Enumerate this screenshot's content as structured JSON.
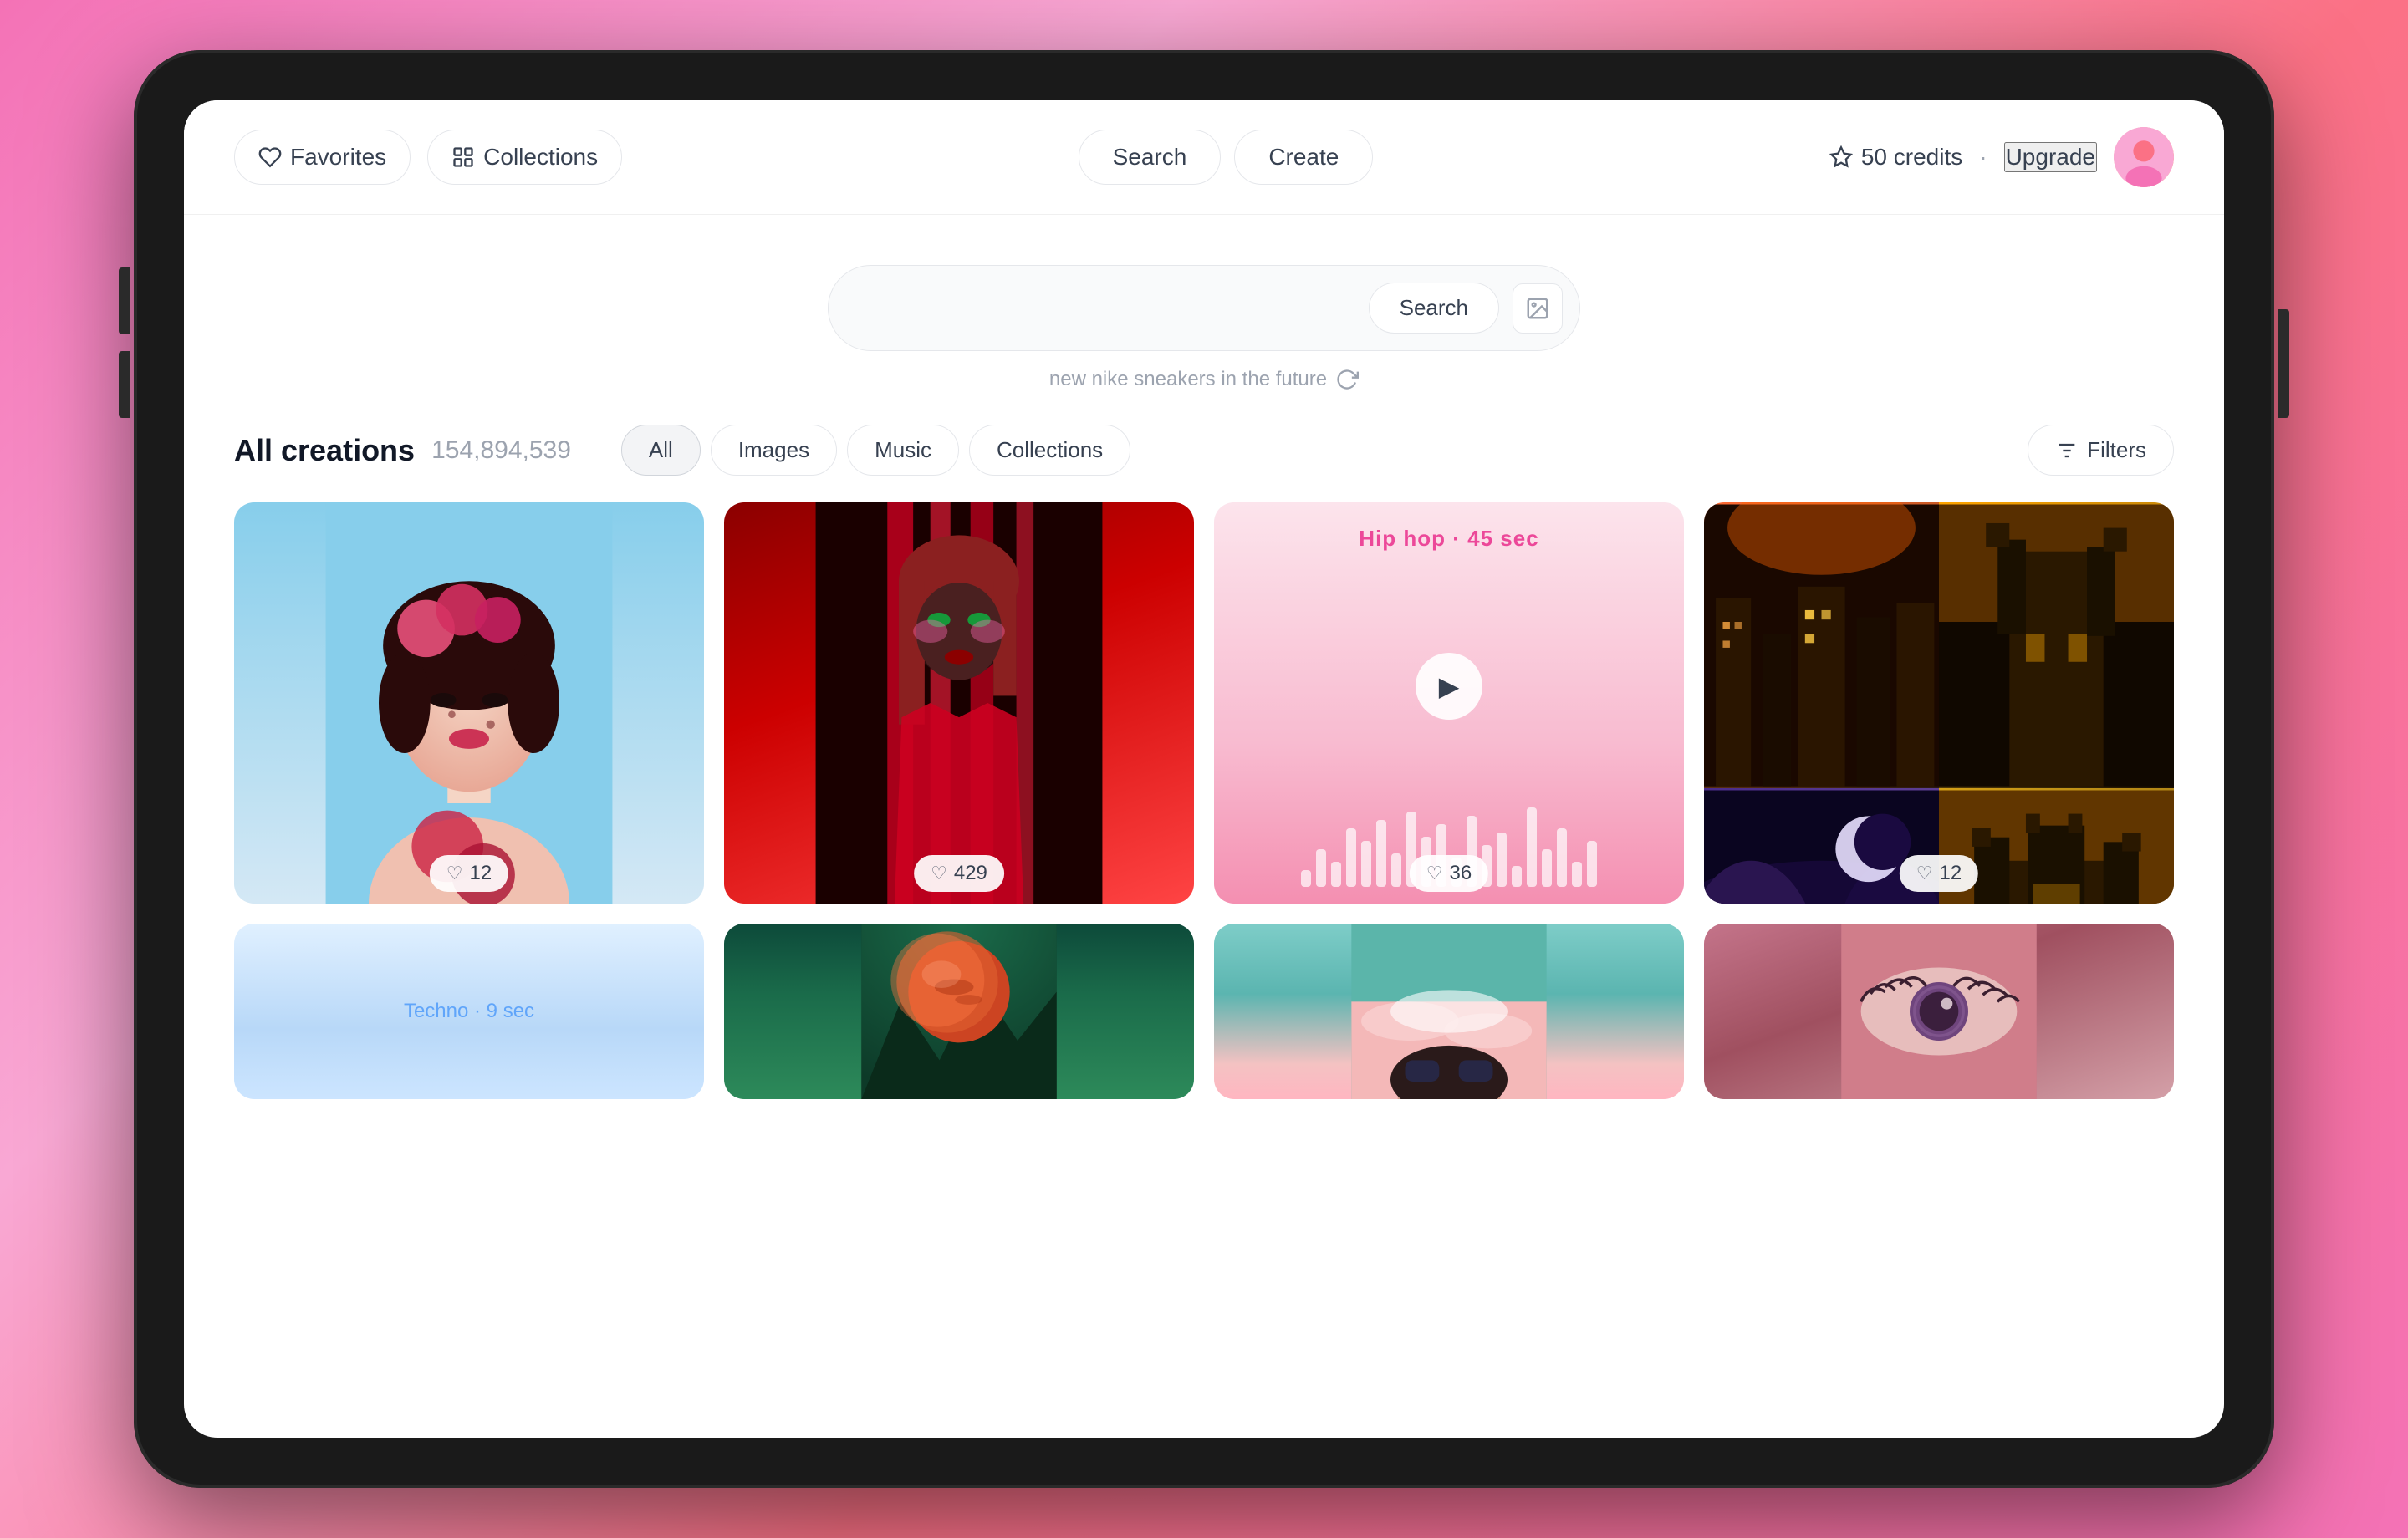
{
  "nav": {
    "favorites_label": "Favorites",
    "collections_label": "Collections",
    "search_label": "Search",
    "create_label": "Create",
    "credits_label": "50 credits",
    "upgrade_label": "Upgrade"
  },
  "search": {
    "placeholder": "",
    "hint": "new nike sneakers in the future",
    "submit_label": "Search"
  },
  "creations": {
    "title": "All creations",
    "count": "154,894,539"
  },
  "filter_tabs": [
    {
      "label": "All",
      "active": true
    },
    {
      "label": "Images",
      "active": false
    },
    {
      "label": "Music",
      "active": false
    },
    {
      "label": "Collections",
      "active": false
    }
  ],
  "filters_label": "Filters",
  "grid_items": [
    {
      "id": "asian-woman",
      "type": "image",
      "likes": 12
    },
    {
      "id": "red-woman",
      "type": "image",
      "likes": 429
    },
    {
      "id": "hiphop-music",
      "type": "music",
      "label": "Hip hop · 45 sec",
      "likes": 36
    },
    {
      "id": "fantasy-cities",
      "type": "image",
      "likes": 12
    },
    {
      "id": "techno-music",
      "type": "music",
      "label": "Techno · 9 sec"
    },
    {
      "id": "planet",
      "type": "image"
    },
    {
      "id": "woman-glasses",
      "type": "image"
    },
    {
      "id": "eye-closeup",
      "type": "image"
    }
  ],
  "waveform_bars": [
    20,
    45,
    30,
    70,
    55,
    80,
    40,
    90,
    60,
    75,
    35,
    85,
    50,
    65,
    25,
    95,
    45,
    70,
    30,
    55
  ]
}
